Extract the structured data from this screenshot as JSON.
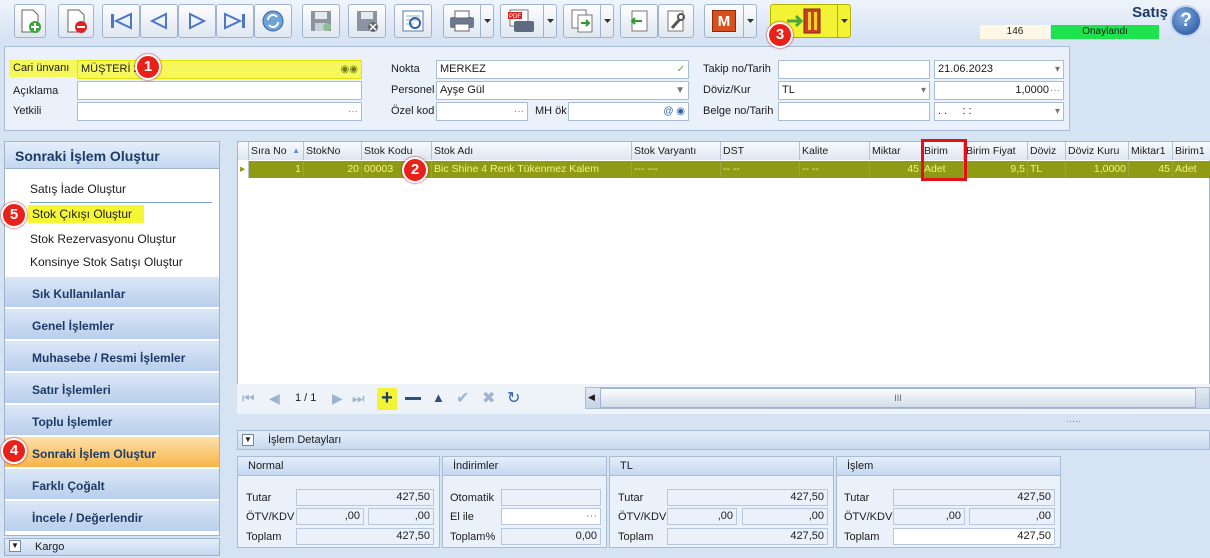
{
  "window": {
    "title": "Satış",
    "count": "146",
    "status": "Onaylandı",
    "help": "?"
  },
  "toolbar": {
    "pdf_label": "PDF",
    "m_label": "M"
  },
  "header": {
    "cari_label": "Cari ünvanı",
    "cari_value": "MÜŞTERİ 2",
    "aciklama_label": "Açıklama",
    "yetkili_label": "Yetkili",
    "nokta_label": "Nokta",
    "nokta_value": "MERKEZ",
    "personel_label": "Personel",
    "personel_value": "Ayşe Gül",
    "ozel_label": "Özel kod",
    "mh_label": "MH ök",
    "takip_label": "Takip no/Tarih",
    "tarih_value": "21.06.2023",
    "doviz_label": "Döviz/Kur",
    "doviz_value": "TL",
    "kur_value": "1,0000",
    "belge_label": "Belge no/Tarih",
    "belge_tarih_value": ". .     : :"
  },
  "left_panel": {
    "head": "Sonraki İşlem Oluştur",
    "items": [
      "Satış İade Oluştur",
      "Stok Çıkışı Oluştur",
      "Stok Rezervasyonu Oluştur",
      "Konsinye Stok Satışı Oluştur"
    ],
    "groups": [
      "Sık Kullanılanlar",
      "Genel İşlemler",
      "Muhasebe / Resmi İşlemler",
      "Satır İşlemleri",
      "Toplu İşlemler",
      "Sonraki İşlem Oluştur",
      "Farklı Çoğalt",
      "İncele / Değerlendir"
    ],
    "kargo": "Kargo"
  },
  "grid": {
    "columns": [
      "Sıra No",
      "StokNo",
      "Stok Kodu",
      "Stok Adı",
      "Stok Varyantı",
      "DST",
      "Kalite",
      "Miktar",
      "Birim",
      "Birim Fiyat",
      "Döviz",
      "Döviz Kuru",
      "Miktar1",
      "Birim1"
    ],
    "row": [
      "1",
      "20",
      "00003",
      "Bic Shine 4 Renk Tükenmez Kalem",
      "--- ---",
      "-- --",
      "-- --",
      "45",
      "Adet",
      "9,5",
      "TL",
      "1,0000",
      "45",
      "Adet"
    ],
    "pager": "1 / 1",
    "scroll_label": "III"
  },
  "details": {
    "bar_label": "İşlem Detayları",
    "normal": {
      "title": "Normal",
      "tutar_label": "Tutar",
      "tutar": "427,50",
      "otv_label": "ÖTV/KDV",
      "otv": ",00",
      "kdv": ",00",
      "toplam_label": "Toplam",
      "toplam": "427,50"
    },
    "indirim": {
      "title": "İndirimler",
      "otomatik_label": "Otomatik",
      "elile_label": "El ile",
      "toplam_label": "Toplam%",
      "toplam": "0,00"
    },
    "tl": {
      "title": "TL",
      "tutar_label": "Tutar",
      "tutar": "427,50",
      "otv_label": "ÖTV/KDV",
      "otv": ",00",
      "kdv": ",00",
      "toplam_label": "Toplam",
      "toplam": "427,50"
    },
    "islem": {
      "title": "İşlem",
      "tutar_label": "Tutar",
      "tutar": "427,50",
      "otv_label": "ÖTV/KDV",
      "otv": ",00",
      "kdv": ",00",
      "toplam_label": "Toplam",
      "toplam": "427,50"
    }
  },
  "badges": [
    "1",
    "2",
    "3",
    "4",
    "5"
  ]
}
